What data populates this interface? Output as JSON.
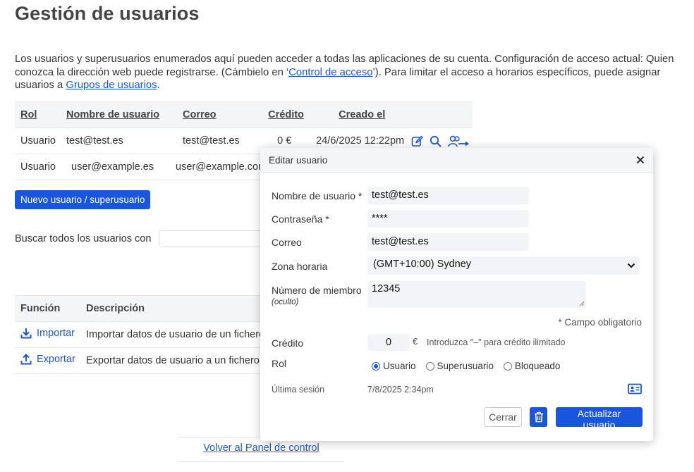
{
  "page": {
    "title": "Gestión de usuarios",
    "intro_1": "Los usuarios y superusuarios enumerados aquí pueden acceder a todas las aplicaciones de su cuenta. Configuración de acceso actual: Quien conozca la dirección web puede registrarse. (Cámbielo en ‘",
    "intro_link_1": "Control de acceso",
    "intro_2": "’). Para limitar el acceso a horarios específicos, puede asignar usuarios a ",
    "intro_link_2": "Grupos de usuarios",
    "intro_3": "."
  },
  "users_table": {
    "headers": [
      "Rol",
      "Nombre de usuario",
      "Correo",
      "Crédito",
      "Creado el"
    ],
    "rows": [
      [
        "Usuario",
        "test@test.es",
        "test@test.es",
        "0 €",
        "24/6/2025 12:22pm"
      ],
      [
        "Usuario",
        "user@example.es",
        "user@example.com",
        "",
        ""
      ]
    ],
    "row_icons": [
      "edit-icon",
      "search-icon",
      "user-transfer-icon"
    ]
  },
  "new_user_button": "Nuevo usuario / superusuario",
  "search": {
    "label": "Buscar todos los usuarios con",
    "value": ""
  },
  "functions_table": {
    "headers": [
      "Función",
      "Descripción"
    ],
    "rows": [
      {
        "name": "Importar",
        "icon": "download-icon",
        "description": "Importar datos de usuario de un fichero"
      },
      {
        "name": "Exportar",
        "icon": "upload-icon",
        "description": "Exportar datos de usuario a un fichero"
      }
    ]
  },
  "back_link": "Volver al Panel de control",
  "modal": {
    "title": "Editar usuario",
    "username_label": "Nombre de usuario *",
    "username_value": "test@test.es",
    "password_label": "Contraseña *",
    "password_value": "****",
    "email_label": "Correo",
    "email_value": "test@test.es",
    "timezone_label": "Zona horaria",
    "timezone_value": "(GMT+10:00) Sydney",
    "member_label": "Número de miembro",
    "member_hidden": "(oculto)",
    "member_value": "12345",
    "required_note": "* Campo obligatorio",
    "credit_label": "Crédito",
    "credit_value": "0",
    "currency": "€",
    "credit_hint": "Introduzca \"–\" para crédito ilimitado",
    "role_label": "Rol",
    "roles": [
      "Usuario",
      "Superusuario",
      "Bloqueado"
    ],
    "selected_role": "Usuario",
    "last_session_label": "Última sesión",
    "last_session_value": "7/8/2025 2:34pm",
    "close_button": "Cerrar",
    "update_button": "Actualizar usuario"
  },
  "colors": {
    "accent": "#1a56db",
    "header_bg": "#f3f5f7",
    "field_bg": "#f2f4f7"
  }
}
